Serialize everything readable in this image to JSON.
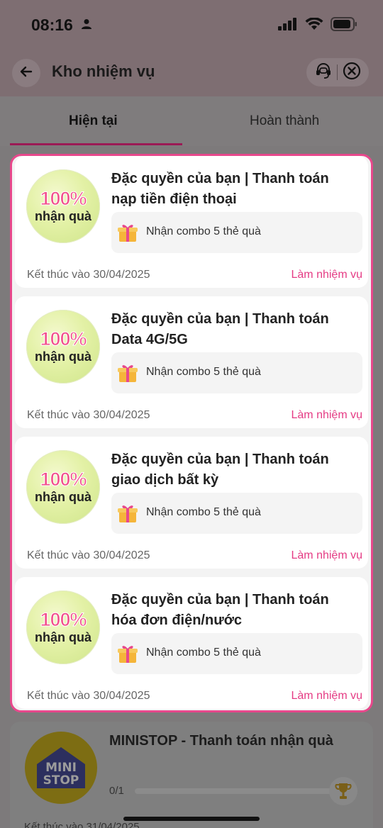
{
  "status_bar": {
    "time": "08:16"
  },
  "header": {
    "title": "Kho nhiệm vụ"
  },
  "tabs": [
    {
      "label": "Hiện tại",
      "active": true
    },
    {
      "label": "Hoàn thành",
      "active": false
    }
  ],
  "tasks": [
    {
      "badge_pct": "100%",
      "badge_text": "nhận quà",
      "title": "Đặc quyền của bạn | Thanh toán nạp tiền điện thoại",
      "reward": "Nhận combo 5 thẻ quà",
      "end_date": "Kết thúc vào 30/04/2025",
      "action": "Làm nhiệm vụ"
    },
    {
      "badge_pct": "100%",
      "badge_text": "nhận quà",
      "title": "Đặc quyền của bạn | Thanh toán Data 4G/5G",
      "reward": "Nhận combo 5 thẻ quà",
      "end_date": "Kết thúc vào 30/04/2025",
      "action": "Làm nhiệm vụ"
    },
    {
      "badge_pct": "100%",
      "badge_text": "nhận quà",
      "title": "Đặc quyền của bạn | Thanh toán giao dịch bất kỳ",
      "reward": "Nhận combo 5 thẻ quà",
      "end_date": "Kết thúc vào 30/04/2025",
      "action": "Làm nhiệm vụ"
    },
    {
      "badge_pct": "100%",
      "badge_text": "nhận quà",
      "title": "Đặc quyền của bạn | Thanh toán hóa đơn điện/nước",
      "reward": "Nhận combo 5 thẻ quà",
      "end_date": "Kết thúc vào 30/04/2025",
      "action": "Làm nhiệm vụ"
    }
  ],
  "other_task": {
    "logo_text_1": "MINI",
    "logo_text_2": "STOP",
    "title": "MINISTOP - Thanh toán nhận quà",
    "progress": "0/1",
    "progress_fraction": 0,
    "end_date": "Kết thúc vào 31/04/2025"
  },
  "colors": {
    "accent": "#e53b84",
    "frame_border": "#e8488c",
    "tab_indicator": "#9b1a55"
  }
}
